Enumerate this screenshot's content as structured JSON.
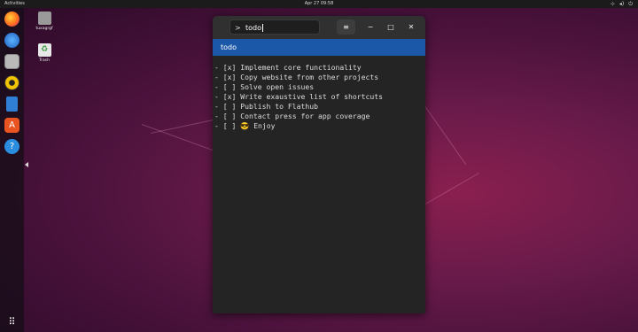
{
  "topbar": {
    "activities": "Activities",
    "clock": "Apr 27  09:58",
    "tray_icons": [
      "network-icon",
      "volume-icon",
      "power-icon"
    ]
  },
  "dock": {
    "items": [
      "firefox-icon",
      "thunderbird-icon",
      "files-icon",
      "rhythmbox-icon",
      "writer-icon",
      "software-icon",
      "help-icon"
    ],
    "apps_grid": "apps-grid-icon"
  },
  "desktop": {
    "items": [
      {
        "label": "tuxagrgf"
      },
      {
        "label": "Trash"
      }
    ]
  },
  "window": {
    "search_value": "todo",
    "result_label": "todo",
    "lines": [
      "- [x] Implement core functionality",
      "- [x] Copy website from other projects",
      "- [ ] Solve open issues",
      "- [x] Write exaustive list of shortcuts",
      "- [ ] Publish to Flathub",
      "- [ ] Contact press for app coverage",
      "- [ ] 😎 Enjoy"
    ],
    "menu_glyph": "≡",
    "min_glyph": "−",
    "max_glyph": "□",
    "close_glyph": "✕",
    "chevron_glyph": ">"
  },
  "colors": {
    "accent": "#1c58a8",
    "window_bg": "#242424",
    "header_bg": "#303030"
  }
}
